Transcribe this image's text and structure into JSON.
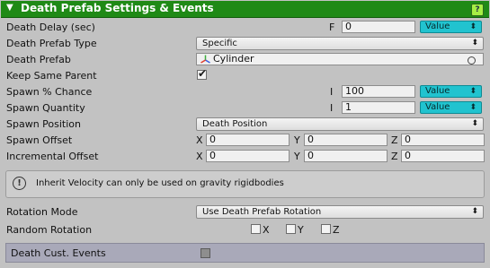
{
  "header": {
    "title": "Death Prefab Settings & Events",
    "help_label": "?"
  },
  "rows": {
    "death_delay": {
      "label": "Death Delay (sec)",
      "type_char": "F",
      "value": "0",
      "mode": "Value"
    },
    "death_prefab_type": {
      "label": "Death Prefab Type",
      "selected": "Specific"
    },
    "death_prefab": {
      "label": "Death Prefab",
      "object": "Cylinder"
    },
    "keep_same_parent": {
      "label": "Keep Same Parent",
      "checked": true
    },
    "spawn_chance": {
      "label": "Spawn % Chance",
      "type_char": "I",
      "value": "100",
      "mode": "Value"
    },
    "spawn_quantity": {
      "label": "Spawn Quantity",
      "type_char": "I",
      "value": "1",
      "mode": "Value"
    },
    "spawn_position": {
      "label": "Spawn Position",
      "selected": "Death Position"
    },
    "spawn_offset": {
      "label": "Spawn Offset",
      "x_label": "X",
      "x": "0",
      "y_label": "Y",
      "y": "0",
      "z_label": "Z",
      "z": "0"
    },
    "incremental_offset": {
      "label": "Incremental Offset",
      "x_label": "X",
      "x": "0",
      "y_label": "Y",
      "y": "0",
      "z_label": "Z",
      "z": "0"
    },
    "rotation_mode": {
      "label": "Rotation Mode",
      "selected": "Use Death Prefab Rotation"
    },
    "random_rotation": {
      "label": "Random Rotation",
      "x_label": "X",
      "y_label": "Y",
      "z_label": "Z"
    }
  },
  "info": {
    "icon_glyph": "!",
    "text": "Inherit Velocity can only be used on gravity rigidbodies"
  },
  "events": {
    "label": "Death Cust. Events"
  },
  "icons": {
    "dropdown_arrow": "⬍",
    "checkmark": "✔",
    "collapse": "▼"
  },
  "colors": {
    "header": "#1f8a16",
    "value_button": "#21c3cf",
    "events_bar": "#a9a9b9"
  }
}
